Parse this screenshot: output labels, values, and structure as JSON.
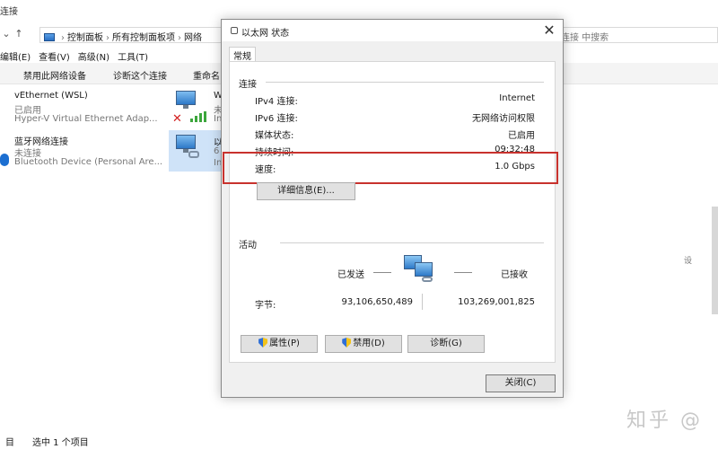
{
  "explorer": {
    "title_fragment": "连接",
    "address": [
      "控制面板",
      "所有控制面板项",
      "网络"
    ],
    "search_fragment": "连接 中搜索",
    "menu": [
      "编辑(E)",
      "查看(V)",
      "高级(N)",
      "工具(T)"
    ],
    "toolbar": [
      "禁用此网络设备",
      "诊断这个连接",
      "重命名"
    ],
    "adapters": [
      {
        "name": "vEthernet (WSL)",
        "status": "已启用",
        "desc": "Hyper-V Virtual Ethernet Adap..."
      },
      {
        "name": "蓝牙网络连接",
        "status": "未连接",
        "desc": "Bluetooth Device (Personal Are..."
      }
    ],
    "adapter_right_top": {
      "name_cut": "W",
      "status_cut": "未",
      "desc_cut": "In"
    },
    "adapter_right_bottom": {
      "name_cut": "以",
      "status_cut": "6",
      "desc_cut": "In"
    },
    "status_bar": [
      "目",
      "选中 1 个项目"
    ],
    "right_side_text": "设",
    "watermark": "知乎 @"
  },
  "dialog": {
    "title": "以太网 状态",
    "close_glyph": "✕",
    "tab": "常规",
    "connection": {
      "heading": "连接",
      "rows": [
        {
          "label": "IPv4 连接:",
          "value": "Internet"
        },
        {
          "label": "IPv6 连接:",
          "value": "无网络访问权限"
        },
        {
          "label": "媒体状态:",
          "value": "已启用"
        },
        {
          "label": "持续时间:",
          "value": "09:32:48"
        },
        {
          "label": "速度:",
          "value": "1.0 Gbps"
        }
      ],
      "details_button": "详细信息(E)..."
    },
    "activity": {
      "heading": "活动",
      "sent_label": "已发送",
      "received_label": "已接收",
      "bytes_label": "字节:",
      "bytes_sent": "93,106,650,489",
      "bytes_received": "103,269,001,825"
    },
    "buttons": {
      "properties": "属性(P)",
      "disable": "禁用(D)",
      "diagnose": "诊断(G)"
    },
    "close_button": "关闭(C)"
  },
  "colors": {
    "highlight": "#c8322d",
    "dialog_bg": "#f0f0f0",
    "panel_bg": "#ffffff",
    "selection": "#cfe3f8"
  }
}
